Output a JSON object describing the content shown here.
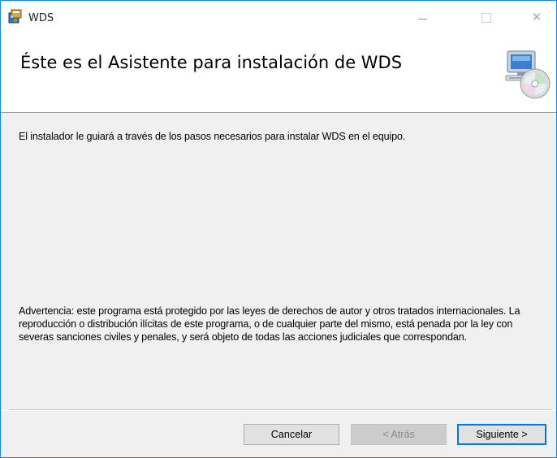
{
  "window": {
    "title": "WDS",
    "close_glyph": "✕"
  },
  "header": {
    "heading": "Éste es el Asistente para instalación de WDS",
    "icon": "computer-cd-icon"
  },
  "content": {
    "intro": "El instalador le guiará a través de los pasos necesarios para instalar WDS en el equipo.",
    "warning": "Advertencia: este programa está protegido por las leyes de derechos de autor y otros tratados internacionales. La reproducción o distribución ilícitas de este programa, o de cualquier parte del mismo, está penada por la ley con severas sanciones civiles y penales, y será objeto de todas las acciones judiciales que correspondan."
  },
  "footer": {
    "cancel_label": "Cancelar",
    "back_label": "< Atrás",
    "next_label": "Siguiente >"
  },
  "colors": {
    "window_border": "#1883d7",
    "panel_background": "#f0f0f0",
    "focus_border": "#0078d7"
  }
}
